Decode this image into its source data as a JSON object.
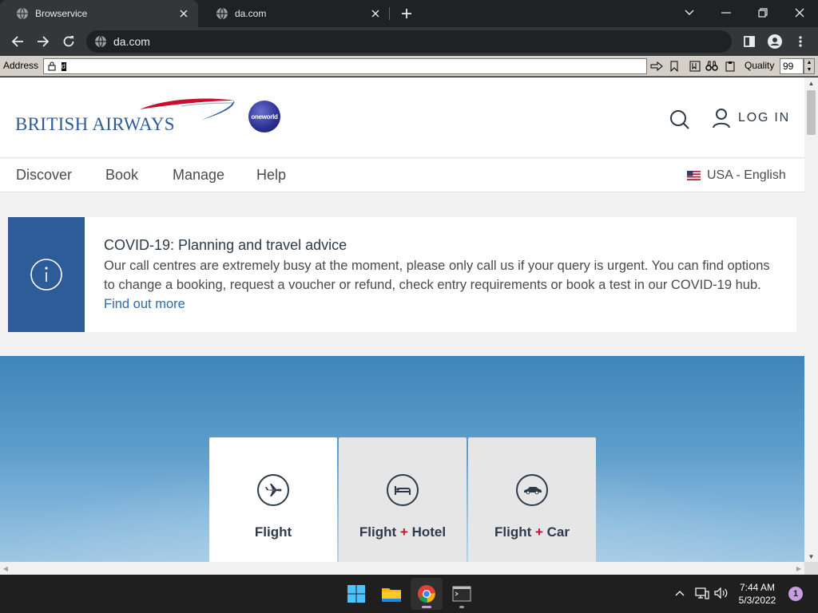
{
  "browser": {
    "tabs": [
      {
        "title": "Browservice",
        "icon": "globe-icon"
      },
      {
        "title": "da.com",
        "icon": "globe-icon"
      }
    ],
    "omnibox_url": "da.com"
  },
  "browservice": {
    "address_label": "Address",
    "address_value": "d",
    "quality_label": "Quality",
    "quality_value": "99"
  },
  "site": {
    "brand": "BRITISH AIRWAYS",
    "partner_badge": "oneworld",
    "login_label": "LOG IN",
    "nav": [
      "Discover",
      "Book",
      "Manage",
      "Help"
    ],
    "locale": "USA - English",
    "covid": {
      "title": "COVID-19: Planning and travel advice",
      "body": "Our call centres are extremely busy at the moment, please only call us if your query is urgent. You can find options to change a booking, request a voucher or refund, check entry requirements or book a test in our COVID-19 hub. ",
      "link": "Find out more"
    },
    "product_tabs": [
      {
        "part1": "Flight",
        "plus": "",
        "part2": "",
        "icon": "plane-icon"
      },
      {
        "part1": "Flight ",
        "plus": "+",
        "part2": " Hotel",
        "icon": "bed-icon"
      },
      {
        "part1": "Flight ",
        "plus": "+",
        "part2": " Car",
        "icon": "car-icon"
      }
    ],
    "colors": {
      "brand_blue": "#2e5c99",
      "accent_red": "#c8102e",
      "link": "#2e6aa8"
    }
  },
  "taskbar": {
    "time": "7:44 AM",
    "date": "5/3/2022",
    "notifications": "1"
  }
}
